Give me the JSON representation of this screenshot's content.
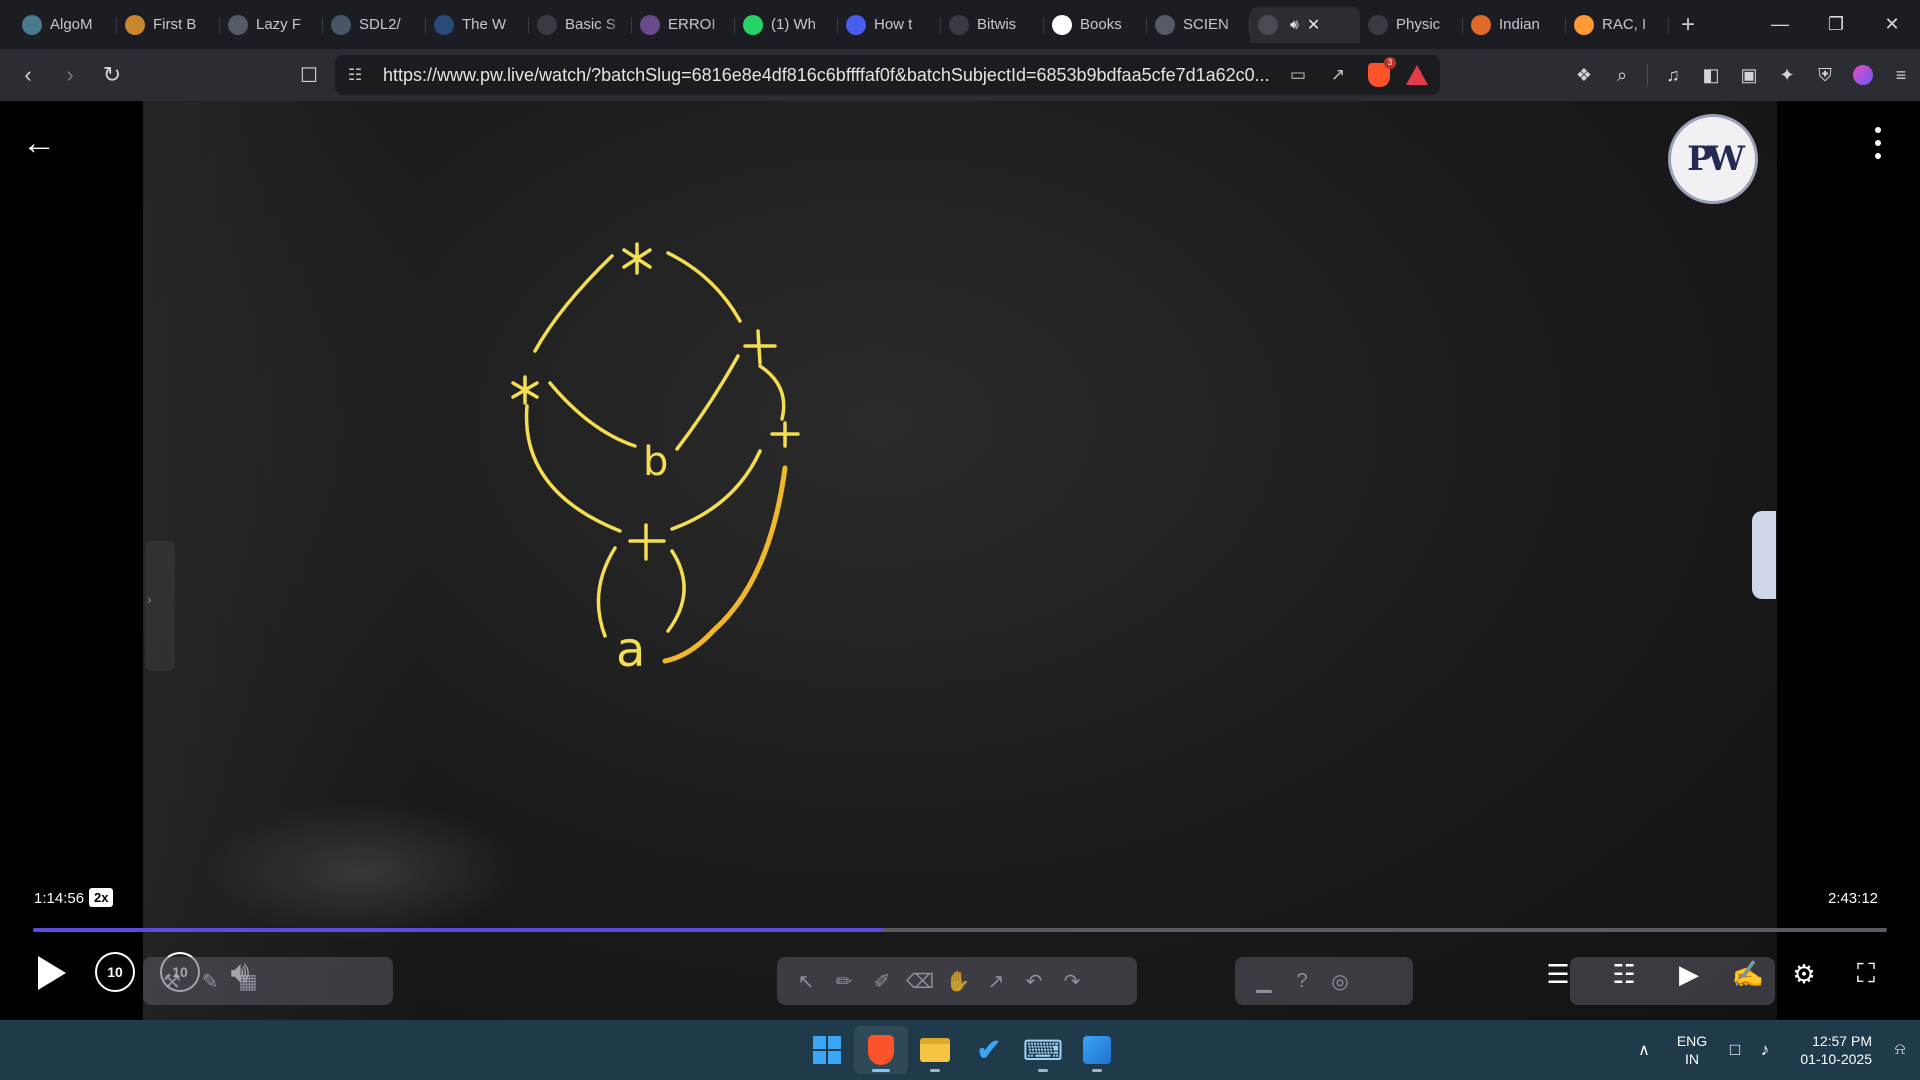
{
  "browser": {
    "tabs": [
      {
        "title": "AlgoM",
        "favicon_color": "#4a7a8c",
        "icon": "algo-icon"
      },
      {
        "title": "First B",
        "favicon_color": "#c8872f",
        "icon": "sun-icon"
      },
      {
        "title": "Lazy F",
        "favicon_color": "#555a66",
        "icon": "globe-icon"
      },
      {
        "title": "SDL2/",
        "favicon_color": "#4a5566",
        "icon": "sdl-icon"
      },
      {
        "title": "The W",
        "favicon_color": "#2a4a7a",
        "icon": "wordpress-icon"
      },
      {
        "title": "Basic S",
        "favicon_color": "#3a3b42",
        "icon": "html-icon"
      },
      {
        "title": "ERROI",
        "favicon_color": "#6a4a8a",
        "icon": "error-icon"
      },
      {
        "title": "(1) Wh",
        "favicon_color": "#25d366",
        "icon": "whatsapp-icon"
      },
      {
        "title": "How t",
        "favicon_color": "#4a5df0",
        "icon": "bookmark-icon"
      },
      {
        "title": "Bitwis",
        "favicon_color": "#3a3b42",
        "icon": "bitwise-icon"
      },
      {
        "title": "Books",
        "favicon_color": "#ffffff",
        "icon": "google-icon"
      },
      {
        "title": "SCIEN",
        "favicon_color": "#555a66",
        "icon": "globe-icon"
      },
      {
        "title": "",
        "favicon_color": "#4a4a52",
        "icon": "pw-tab-icon",
        "active": true
      },
      {
        "title": "Physic",
        "favicon_color": "#3a3b42",
        "icon": "wiki-icon"
      },
      {
        "title": "Indian",
        "favicon_color": "#e06a2a",
        "icon": "indian-icon"
      },
      {
        "title": "RAC, I",
        "favicon_color": "#ff9933",
        "icon": "flag-india-icon"
      }
    ],
    "new_tab": "+",
    "url": "https://www.pw.live/watch/?batchSlug=6816e8e4df816c6bffffaf0f&batchSubjectId=6853b9bdfaa5cfe7d1a62c0...",
    "brave_badge": "3"
  },
  "player": {
    "current_time": "1:14:56",
    "speed": "2x",
    "total_time": "2:43:12",
    "progress_fraction": 0.4589,
    "skip_back": "10",
    "skip_forward": "10",
    "logo_text": "PW"
  },
  "taskbar": {
    "lang_line1": "ENG",
    "lang_line2": "IN",
    "time": "12:57 PM",
    "date": "01-10-2025"
  }
}
